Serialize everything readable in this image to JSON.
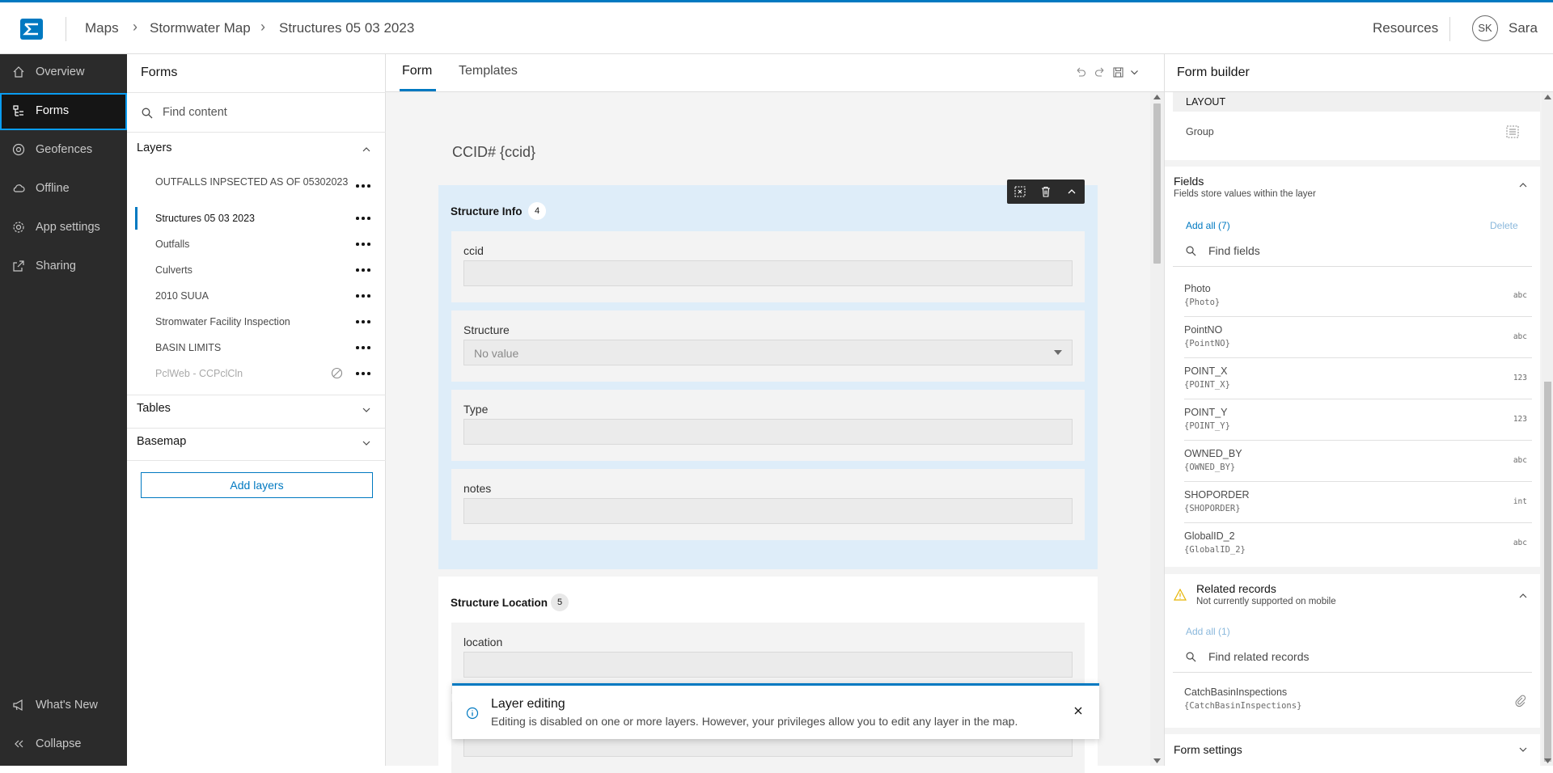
{
  "topbar": {
    "breadcrumbs": [
      "Maps",
      "Stormwater Map",
      "Structures 05 03 2023"
    ],
    "resources_label": "Resources",
    "user_initials": "SK",
    "user_name": "Sara"
  },
  "leftnav": {
    "items": [
      {
        "label": "Overview",
        "icon": "home-icon"
      },
      {
        "label": "Forms",
        "icon": "forms-icon"
      },
      {
        "label": "Geofences",
        "icon": "geofence-icon"
      },
      {
        "label": "Offline",
        "icon": "cloud-icon"
      },
      {
        "label": "App settings",
        "icon": "gear-icon"
      },
      {
        "label": "Sharing",
        "icon": "share-icon"
      }
    ],
    "whats_new": "What's New",
    "collapse": "Collapse"
  },
  "forms_panel": {
    "title": "Forms",
    "search_placeholder": "Find content",
    "layers_label": "Layers",
    "layers": [
      "OUTFALLS INPSECTED AS OF 05302023",
      "Structures 05 03 2023",
      "Outfalls",
      "Culverts",
      "2010 SUUA",
      "Stromwater Facility Inspection",
      "BASIN LIMITS",
      "PclWeb - CCPclCln"
    ],
    "tables_label": "Tables",
    "basemap_label": "Basemap",
    "add_layers_label": "Add layers"
  },
  "center": {
    "tabs": [
      "Form",
      "Templates"
    ],
    "form_title": "CCID# {ccid}",
    "group1": {
      "title": "Structure Info",
      "count": "4",
      "fields": [
        {
          "label": "ccid",
          "value": ""
        },
        {
          "label": "Structure",
          "value": "No value"
        },
        {
          "label": "Type",
          "value": ""
        },
        {
          "label": "notes",
          "value": ""
        }
      ]
    },
    "group2": {
      "title": "Structure Location",
      "count": "5",
      "fields": [
        {
          "label": "location",
          "value": ""
        }
      ]
    },
    "toast": {
      "title": "Layer editing",
      "message": "Editing is disabled on one or more layers. However, your privileges allow you to edit any layer in the map."
    }
  },
  "right": {
    "title": "Form builder",
    "layout_label": "LAYOUT",
    "group_label": "Group",
    "fields_title": "Fields",
    "fields_sub": "Fields store values within the layer",
    "add_all": "Add all (7)",
    "delete": "Delete",
    "find_fields": "Find fields",
    "fields": [
      {
        "name": "Photo",
        "key": "{Photo}",
        "type": "abc"
      },
      {
        "name": "PointNO",
        "key": "{PointNO}",
        "type": "abc"
      },
      {
        "name": "POINT_X",
        "key": "{POINT_X}",
        "type": "123"
      },
      {
        "name": "POINT_Y",
        "key": "{POINT_Y}",
        "type": "123"
      },
      {
        "name": "OWNED_BY",
        "key": "{OWNED_BY}",
        "type": "abc"
      },
      {
        "name": "SHOPORDER",
        "key": "{SHOPORDER}",
        "type": "int"
      },
      {
        "name": "GlobalID_2",
        "key": "{GlobalID_2}",
        "type": "abc"
      }
    ],
    "related_title": "Related records",
    "related_sub": "Not currently supported on mobile",
    "related_add_all": "Add all (1)",
    "find_related": "Find related records",
    "related": [
      {
        "name": "CatchBasinInspections",
        "key": "{CatchBasinInspections}"
      }
    ],
    "form_settings": "Form settings"
  },
  "colors": {
    "accent": "#0079c1",
    "nav_bg": "#2b2b2b",
    "group_bg": "#deedf9",
    "warning": "#e6b400"
  }
}
